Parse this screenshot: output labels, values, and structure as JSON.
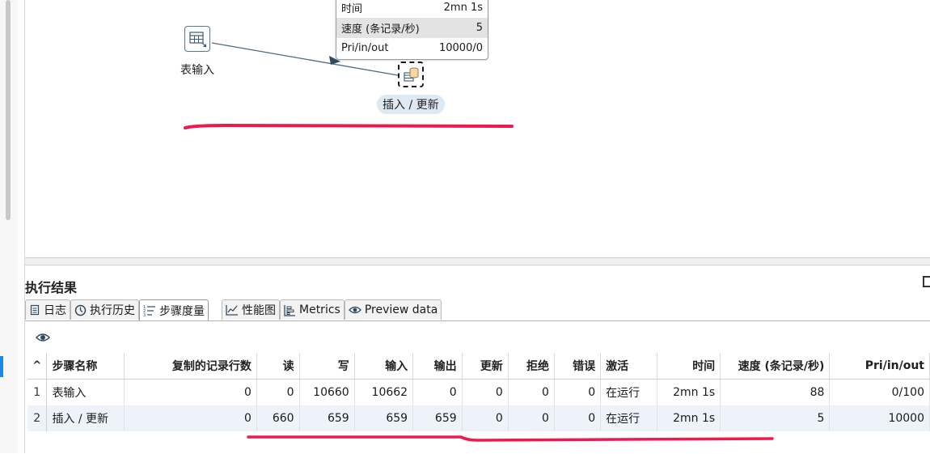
{
  "canvas": {
    "steps": [
      {
        "label": "表输入",
        "icon": "table-input-icon"
      },
      {
        "label": "插入 / 更新",
        "icon": "insert-update-icon"
      }
    ],
    "tooltip": {
      "rows": [
        {
          "key": "时间",
          "value": "2mn 1s"
        },
        {
          "key": "速度 (条记录/秒)",
          "value": "5"
        },
        {
          "key": "Pri/in/out",
          "value": "10000/0"
        }
      ]
    },
    "annotation_color": "#f0194d"
  },
  "results": {
    "title": "执行结果",
    "tabs": [
      {
        "label": "日志",
        "icon": "log-icon"
      },
      {
        "label": "执行历史",
        "icon": "history-icon"
      },
      {
        "label": "步骤度量",
        "icon": "step-metrics-icon",
        "active": true
      },
      {
        "label": "性能图",
        "icon": "performance-chart-icon"
      },
      {
        "label": "Metrics",
        "icon": "metrics-icon"
      },
      {
        "label": "Preview data",
        "icon": "eye-icon"
      }
    ],
    "columns": [
      "步骤名称",
      "复制的记录行数",
      "读",
      "写",
      "输入",
      "输出",
      "更新",
      "拒绝",
      "错误",
      "激活",
      "时间",
      "速度 (条记录/秒)",
      "Pri/in/out"
    ],
    "rows": [
      [
        "1",
        "表输入",
        "0",
        "0",
        "10660",
        "10662",
        "0",
        "0",
        "0",
        "0",
        "在运行",
        "2mn 1s",
        "88",
        "0/100"
      ],
      [
        "2",
        "插入 / 更新",
        "0",
        "660",
        "659",
        "659",
        "659",
        "0",
        "0",
        "0",
        "在运行",
        "2mn 1s",
        "5",
        "10000"
      ]
    ]
  }
}
